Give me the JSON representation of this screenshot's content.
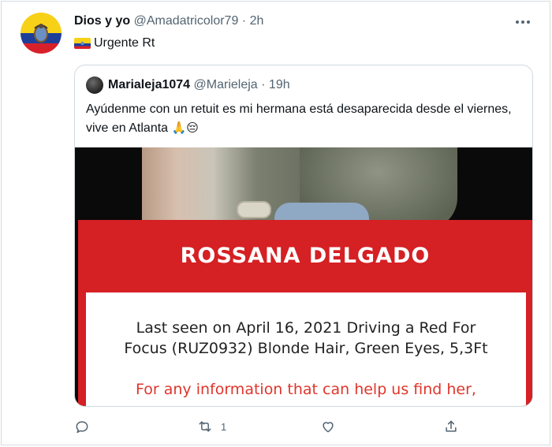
{
  "tweet": {
    "author_name": "Dios y yo",
    "handle": "@Amadatricolor79",
    "separator": "·",
    "time": "2h",
    "text": "Urgente Rt",
    "flag_icon": "ecuador-flag-icon"
  },
  "quoted": {
    "author_name": "Marialeja1074",
    "handle": "@Marieleja",
    "separator": "·",
    "time": "19h",
    "text": "Ayúdenme con un retuit es mi hermana está desaparecida desde el viernes, vive en Atlanta",
    "emojis": "🙏😔",
    "image": {
      "name_banner": "ROSSANA DELGADO",
      "seen_line1": "Last seen on April 16, 2021  Driving a Red For",
      "seen_line2": "Focus (RUZ0932) Blonde Hair, Green Eyes, 5,3Ft",
      "info_line": "For any information that can help us find her,"
    }
  },
  "actions": {
    "reply_icon": "reply-icon",
    "retweet_icon": "retweet-icon",
    "retweet_count": "1",
    "like_icon": "heart-icon",
    "share_icon": "share-icon"
  },
  "colors": {
    "banner_red": "#d52024",
    "info_red": "#e0352b",
    "muted": "#536471"
  }
}
